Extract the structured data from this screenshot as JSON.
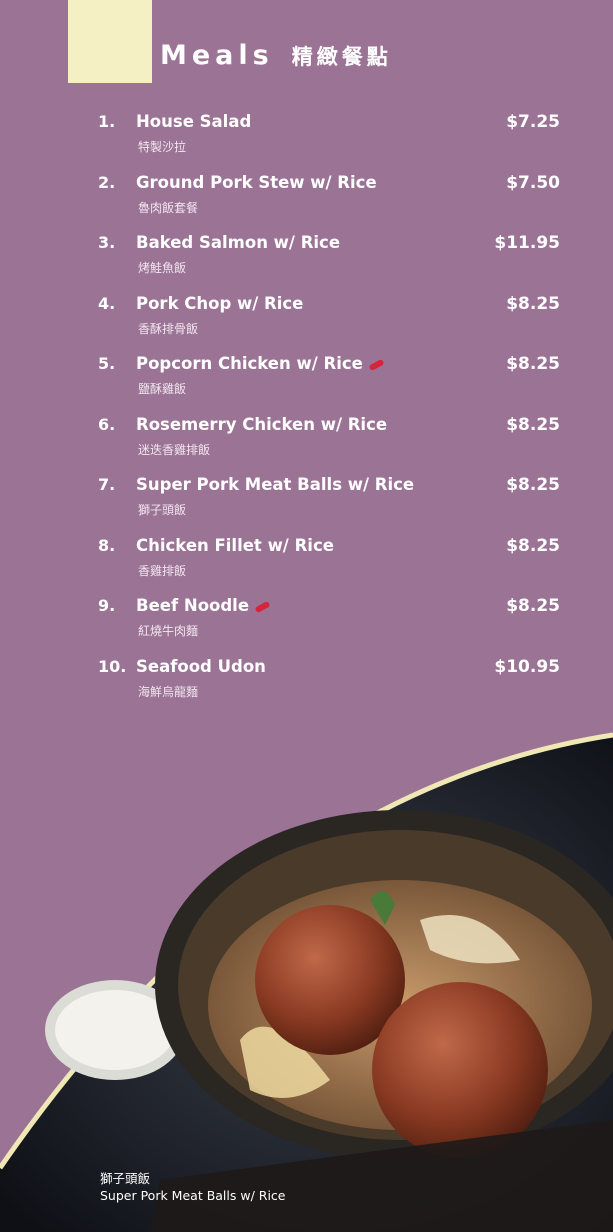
{
  "header": {
    "title": "Meals",
    "title_zh": "精緻餐點"
  },
  "menu": {
    "items": [
      {
        "num": "1.",
        "name": "House Salad",
        "name_zh": "特製沙拉",
        "price": "$7.25",
        "spicy": false
      },
      {
        "num": "2.",
        "name": "Ground Pork Stew w/ Rice",
        "name_zh": "魯肉飯套餐",
        "price": "$7.50",
        "spicy": false
      },
      {
        "num": "3.",
        "name": "Baked Salmon w/ Rice",
        "name_zh": "烤鮭魚飯",
        "price": "$11.95",
        "spicy": false
      },
      {
        "num": "4.",
        "name": "Pork Chop w/ Rice",
        "name_zh": "香酥排骨飯",
        "price": "$8.25",
        "spicy": false
      },
      {
        "num": "5.",
        "name": "Popcorn Chicken w/ Rice",
        "name_zh": "鹽酥雞飯",
        "price": "$8.25",
        "spicy": true
      },
      {
        "num": "6.",
        "name": "Rosemerry Chicken w/ Rice",
        "name_zh": "迷迭香雞排飯",
        "price": "$8.25",
        "spicy": false
      },
      {
        "num": "7.",
        "name": "Super Pork Meat Balls w/ Rice",
        "name_zh": "獅子頭飯",
        "price": "$8.25",
        "spicy": false
      },
      {
        "num": "8.",
        "name": "Chicken Fillet w/ Rice",
        "name_zh": "香雞排飯",
        "price": "$8.25",
        "spicy": false
      },
      {
        "num": "9.",
        "name": "Beef Noodle",
        "name_zh": "紅燒牛肉麵",
        "price": "$8.25",
        "spicy": true
      },
      {
        "num": "10.",
        "name": "Seafood Udon",
        "name_zh": "海鮮烏龍麵",
        "price": "$10.95",
        "spicy": false
      }
    ]
  },
  "photo": {
    "caption_zh": "獅子頭飯",
    "caption_en": "Super Pork Meat Balls w/ Rice"
  },
  "colors": {
    "background": "#9b7395",
    "tab": "#f4f0c4",
    "curve": "#efe8b4",
    "spicy": "#d6243b"
  }
}
